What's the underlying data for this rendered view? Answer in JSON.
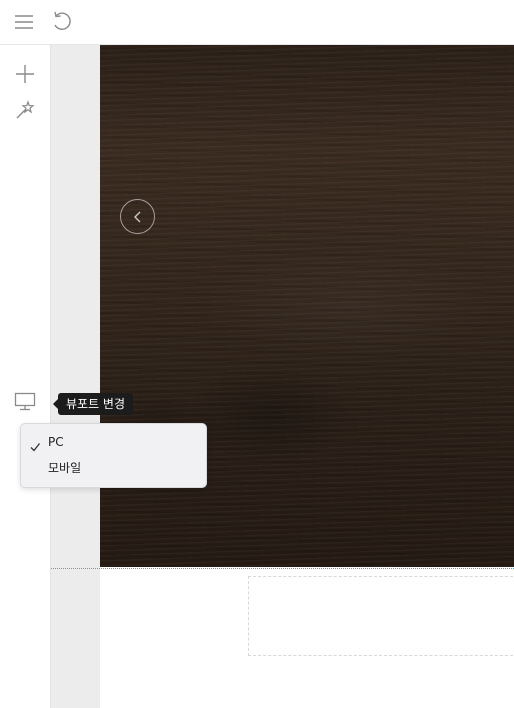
{
  "toolbar": {
    "menu_icon": "hamburger-menu-icon",
    "undo_icon": "undo-icon"
  },
  "sidebar": {
    "add_icon": "plus-icon",
    "magic_icon": "magic-wand-icon",
    "viewport_icon": "monitor-icon"
  },
  "tooltip": {
    "text": "뷰포트 변경"
  },
  "viewport_menu": {
    "items": [
      {
        "label": "PC",
        "selected": true
      },
      {
        "label": "모바일",
        "selected": false
      }
    ]
  },
  "canvas": {
    "hero_prev_icon": "chevron-left-icon",
    "guide_color": "#4aa3df"
  }
}
